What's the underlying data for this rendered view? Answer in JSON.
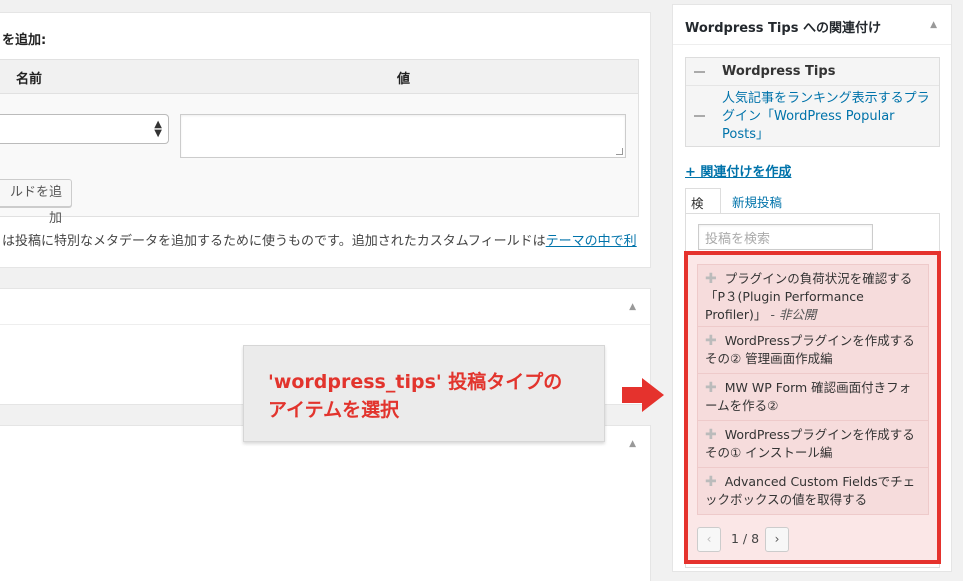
{
  "custom_fields": {
    "heading": "を追加:",
    "col_name": "名前",
    "col_value": "値",
    "add_button": "ルドを追加",
    "description": "は投稿に特別なメタデータを追加するために使うものです。追加されたカスタムフィールドは",
    "description_link": "テーマの中で利"
  },
  "callout": {
    "line1": "'wordpress_tips' 投稿タイプの",
    "line2": "アイテムを選択"
  },
  "sidebar": {
    "title": "Wordpress Tips への関連付け",
    "related_group": "Wordpress Tips",
    "related_item": "人気記事をランキング表示するプラグイン「WordPress Popular Posts」",
    "create_link": "+ 関連付けを作成",
    "tab_search": "検索",
    "tab_new": "新規投稿",
    "search_placeholder": "投稿を検索",
    "results": [
      {
        "title": "プラグインの負荷状況を確認する「P３(Plugin Performance Profiler)」",
        "status": "- 非公開"
      },
      {
        "title": "WordPressプラグインを作成するその② 管理画面作成編",
        "status": ""
      },
      {
        "title": "MW WP Form 確認画面付きフォームを作る②",
        "status": ""
      },
      {
        "title": "WordPressプラグインを作成するその① インストール編",
        "status": ""
      },
      {
        "title": "Advanced Custom Fieldsでチェックボックスの値を取得する",
        "status": ""
      }
    ],
    "pager": {
      "prev": "‹",
      "count": "1 / 8",
      "next": "›"
    }
  },
  "colors": {
    "accent_red": "#e5322d",
    "link_blue": "#0073aa"
  }
}
